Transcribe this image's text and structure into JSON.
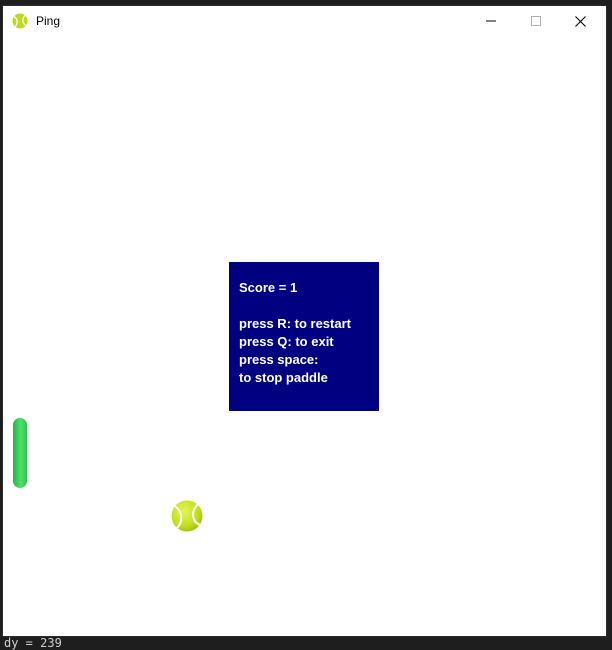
{
  "window": {
    "title": "Ping"
  },
  "backdrop": {
    "bottom_text": "dy = 239"
  },
  "game": {
    "message": {
      "score_line": "Score = 1",
      "restart_line": "press R: to restart",
      "exit_line": "press Q: to exit",
      "space_line": "press space:",
      "stop_line": "to stop paddle"
    },
    "colors": {
      "message_bg": "#000080",
      "paddle": "#33cc55",
      "ball": "#c8e62a"
    },
    "icons": {
      "app": "tennis-ball-icon",
      "ball": "tennis-ball-icon",
      "minimize": "minimize-icon",
      "maximize": "maximize-icon",
      "close": "close-icon"
    }
  }
}
